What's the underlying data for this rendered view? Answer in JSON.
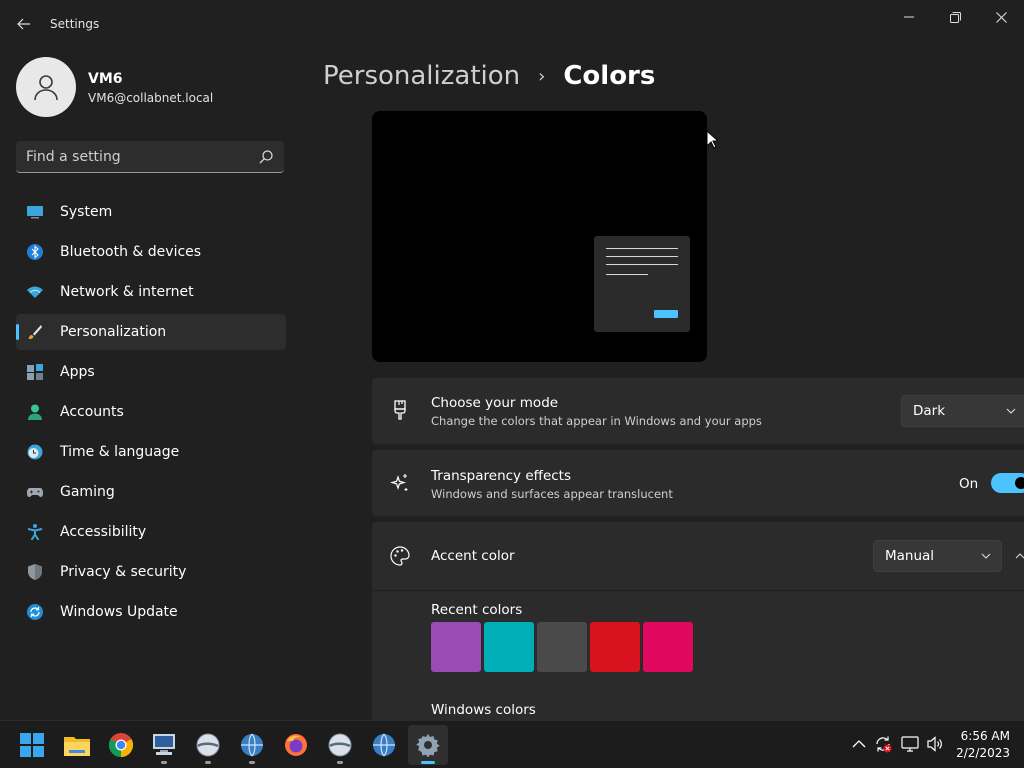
{
  "window": {
    "title": "Settings"
  },
  "profile": {
    "name": "VM6",
    "email": "VM6@collabnet.local"
  },
  "search": {
    "placeholder": "Find a setting"
  },
  "sidebar": {
    "items": [
      {
        "label": "System",
        "icon": "system-icon"
      },
      {
        "label": "Bluetooth & devices",
        "icon": "bluetooth-icon"
      },
      {
        "label": "Network & internet",
        "icon": "wifi-icon"
      },
      {
        "label": "Personalization",
        "icon": "brush-icon",
        "selected": true
      },
      {
        "label": "Apps",
        "icon": "apps-icon"
      },
      {
        "label": "Accounts",
        "icon": "accounts-icon"
      },
      {
        "label": "Time & language",
        "icon": "clock-icon"
      },
      {
        "label": "Gaming",
        "icon": "gamepad-icon"
      },
      {
        "label": "Accessibility",
        "icon": "accessibility-icon"
      },
      {
        "label": "Privacy & security",
        "icon": "shield-icon"
      },
      {
        "label": "Windows Update",
        "icon": "update-icon"
      }
    ]
  },
  "breadcrumb": {
    "parent": "Personalization",
    "separator": "›",
    "current": "Colors"
  },
  "mode": {
    "title": "Choose your mode",
    "subtitle": "Change the colors that appear in Windows and your apps",
    "value": "Dark"
  },
  "transparency": {
    "title": "Transparency effects",
    "subtitle": "Windows and surfaces appear translucent",
    "state": "On"
  },
  "accent": {
    "title": "Accent color",
    "value": "Manual",
    "recent_label": "Recent colors",
    "recent_colors": [
      "#9b4bb4",
      "#00aeb8",
      "#4a4a4a",
      "#d9121f",
      "#e0075e"
    ],
    "windows_label": "Windows colors"
  },
  "colors": {
    "accent": "#4cc2ff",
    "background": "#202020",
    "card": "#2b2b2b"
  },
  "taskbar": {
    "time": "6:56 AM",
    "date": "2/2/2023"
  }
}
